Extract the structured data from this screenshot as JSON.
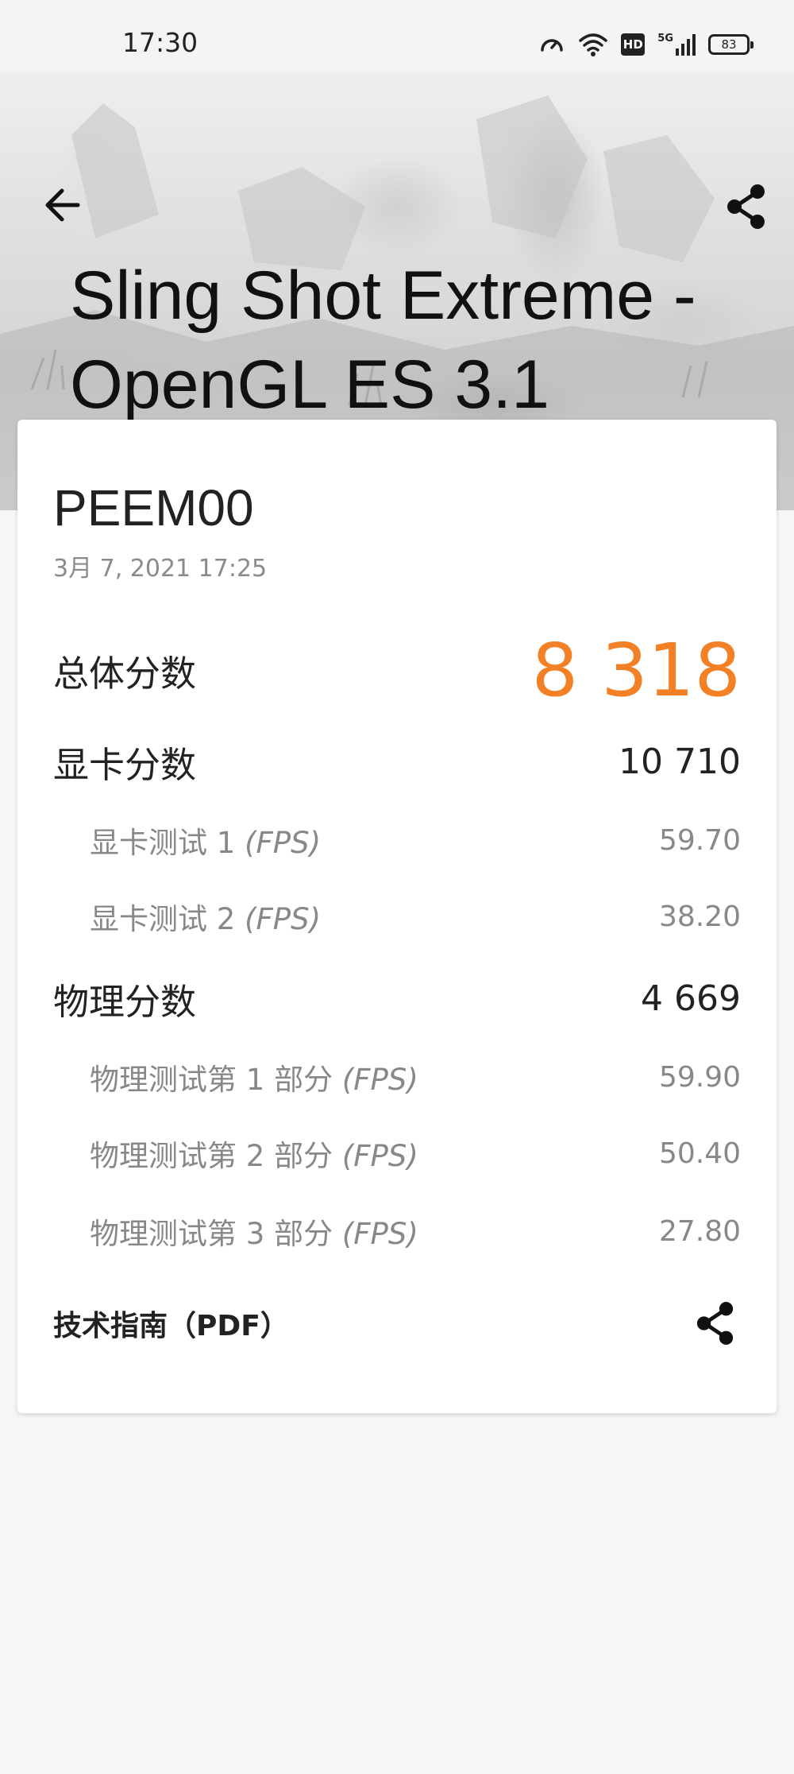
{
  "status_bar": {
    "time": "17:30",
    "network": "5G",
    "hd_label": "HD",
    "battery": "83",
    "icons": [
      "speedometer-icon",
      "wifi-icon",
      "hd-icon",
      "signal-5g-icon",
      "battery-icon"
    ]
  },
  "header": {
    "title": "Sling Shot Extreme - OpenGL ES 3.1",
    "back_icon": "arrow-left-icon",
    "share_icon": "share-icon"
  },
  "result": {
    "device_name": "PEEM00",
    "date": "3月 7, 2021 17:25",
    "overall": {
      "label": "总体分数",
      "value": "8 318"
    },
    "graphics": {
      "label": "显卡分数",
      "value": "10 710"
    },
    "graphics_tests": [
      {
        "label": "显卡测试 1",
        "unit": "(FPS)",
        "value": "59.70"
      },
      {
        "label": "显卡测试 2",
        "unit": "(FPS)",
        "value": "38.20"
      }
    ],
    "physics": {
      "label": "物理分数",
      "value": "4 669"
    },
    "physics_tests": [
      {
        "label": "物理测试第 1 部分",
        "unit": "(FPS)",
        "value": "59.90"
      },
      {
        "label": "物理测试第 2 部分",
        "unit": "(FPS)",
        "value": "50.40"
      },
      {
        "label": "物理测试第 3 部分",
        "unit": "(FPS)",
        "value": "27.80"
      }
    ],
    "pdf": {
      "label": "技术指南（PDF）",
      "icon": "share-icon"
    }
  },
  "colors": {
    "accent": "#f48025",
    "card_bg": "#ffffff",
    "page_bg": "#f6f6f6"
  }
}
